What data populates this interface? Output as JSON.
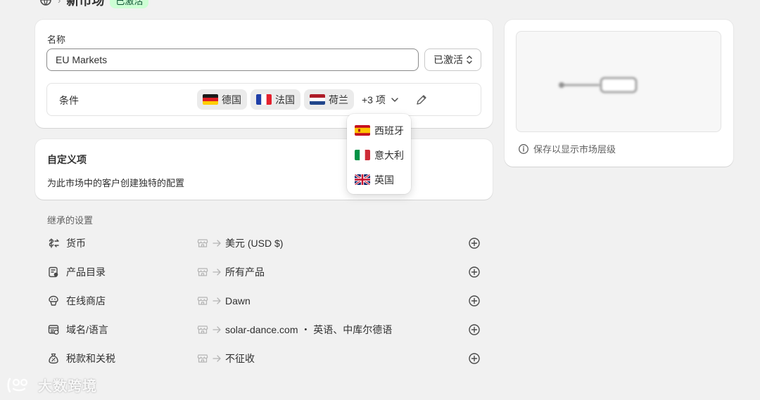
{
  "header": {
    "title": "新市场",
    "status_badge": "已激活",
    "separator": "›"
  },
  "main": {
    "name_label": "名称",
    "name_value": "EU Markets",
    "status_select_value": "已激活",
    "conditions_label": "条件",
    "chips": [
      {
        "label": "德国",
        "flag": "de-flag"
      },
      {
        "label": "法国",
        "flag": "fr-flag"
      },
      {
        "label": "荷兰",
        "flag": "nl-flag"
      }
    ],
    "more_label": "+3 项"
  },
  "dropdown": {
    "items": [
      {
        "label": "西班牙",
        "flag": "es-flag"
      },
      {
        "label": "意大利",
        "flag": "it-flag"
      },
      {
        "label": "英国",
        "flag": "gb-flag"
      }
    ]
  },
  "custom": {
    "title": "自定义项",
    "description": "为此市场中的客户创建独特的配置"
  },
  "inherited": {
    "title": "继承的设置",
    "rows": [
      {
        "label": "货币",
        "value": "美元 (USD $)",
        "icon": "currency-exchange-icon"
      },
      {
        "label": "产品目录",
        "value": "所有产品",
        "icon": "catalog-icon"
      },
      {
        "label": "在线商店",
        "value": "Dawn",
        "icon": "online-store-icon"
      },
      {
        "label": "域名/语言",
        "value": "solar-dance.com ・ 英语、中库尔德语",
        "icon": "domain-icon"
      },
      {
        "label": "税款和关税",
        "value": "不征收",
        "icon": "tax-bag-icon"
      }
    ]
  },
  "side": {
    "hint": "保存以显示市场层级"
  },
  "watermark": {
    "text": "大数跨境"
  },
  "colors": {
    "page_bg": "#f1f1f1",
    "card_bg": "#ffffff",
    "badge_bg": "#cdfed4",
    "badge_text": "#0c5132",
    "chip_bg": "#ebebeb"
  }
}
